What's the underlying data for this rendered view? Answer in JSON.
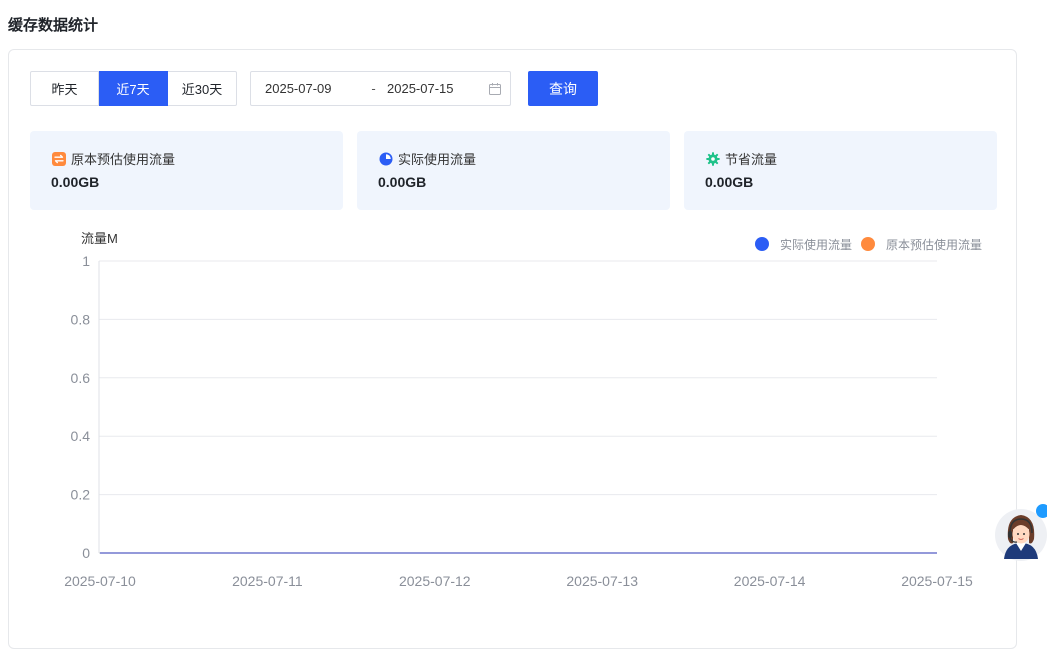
{
  "page": {
    "title": "缓存数据统计"
  },
  "filters": {
    "ranges": [
      "昨天",
      "近7天",
      "近30天"
    ],
    "active_range": "近7天",
    "start_date": "2025-07-09",
    "separator": "-",
    "end_date": "2025-07-15",
    "query_label": "查询"
  },
  "stats": [
    {
      "label": "原本预估使用流量",
      "value": "0.00GB",
      "icon": "swap-icon",
      "color": "#ff8a3d"
    },
    {
      "label": "实际使用流量",
      "value": "0.00GB",
      "icon": "pie-chart-icon",
      "color": "#2b5df5"
    },
    {
      "label": "节省流量",
      "value": "0.00GB",
      "icon": "gear-icon",
      "color": "#1fc28a"
    }
  ],
  "chart_data": {
    "type": "line",
    "ylabel": "流量M",
    "xlabel": "",
    "x": [
      "2025-07-10",
      "2025-07-11",
      "2025-07-12",
      "2025-07-13",
      "2025-07-14",
      "2025-07-15"
    ],
    "ylim": [
      0,
      1
    ],
    "yticks": [
      "0",
      "0.2",
      "0.4",
      "0.6",
      "0.8",
      "1"
    ],
    "series": [
      {
        "name": "实际使用流量",
        "values": [
          0,
          0,
          0,
          0,
          0,
          0
        ],
        "color": "#2b5df5"
      },
      {
        "name": "原本预估使用流量",
        "values": [
          0,
          0,
          0,
          0,
          0,
          0
        ],
        "color": "#ff8a3d"
      }
    ],
    "grid": true,
    "legend": "top-right"
  }
}
